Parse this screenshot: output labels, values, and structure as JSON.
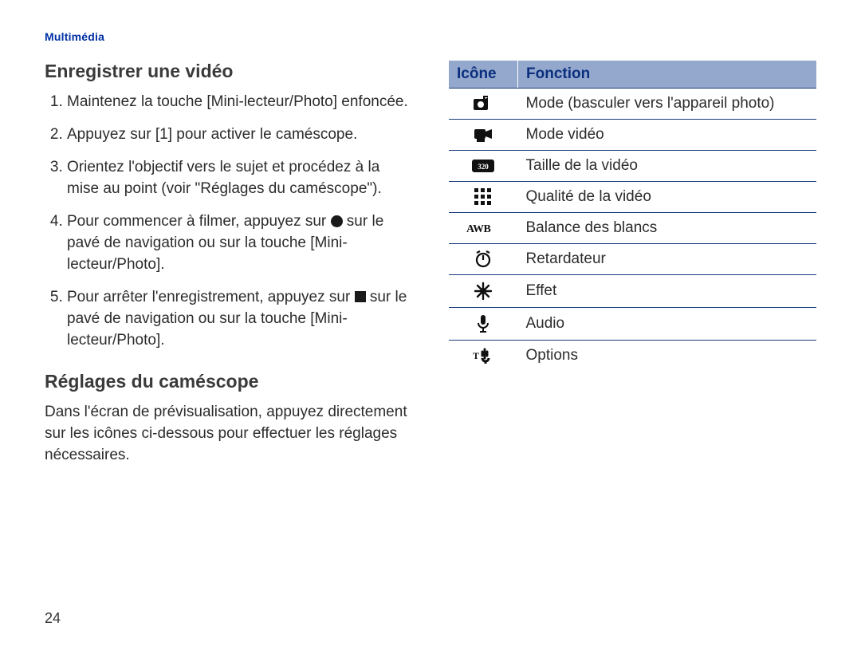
{
  "header": {
    "section": "Multimédia"
  },
  "left": {
    "h1": "Enregistrer une vidéo",
    "steps": [
      "Maintenez la touche [Mini-lecteur/Photo] enfoncée.",
      "Appuyez sur [1] pour activer le caméscope.",
      "Orientez l'objectif vers le sujet et procédez à la mise au point (voir \"Réglages du caméscope\").",
      {
        "pre": "Pour commencer à filmer, appuyez sur ",
        "glyph": "dot",
        "post": " sur le pavé de navigation ou sur la touche [Mini-lecteur/Photo]."
      },
      {
        "pre": "Pour arrêter l'enregistrement, appuyez sur ",
        "glyph": "square",
        "post": " sur le pavé de navigation ou sur la touche [Mini-lecteur/Photo]."
      }
    ],
    "h2": "Réglages du caméscope",
    "intro": "Dans l'écran de prévisualisation, appuyez directement sur les icônes ci-dessous pour effectuer les réglages nécessaires."
  },
  "table": {
    "head_icon": "Icône",
    "head_fn": "Fonction",
    "rows": [
      {
        "icon": "camera-switch-icon",
        "label": "Mode (basculer vers l'appareil photo)"
      },
      {
        "icon": "video-mode-icon",
        "label": "Mode vidéo"
      },
      {
        "icon": "video-size-icon",
        "label": "Taille de la vidéo"
      },
      {
        "icon": "video-quality-icon",
        "label": "Qualité de la vidéo"
      },
      {
        "icon": "white-balance-icon",
        "label": "Balance des blancs"
      },
      {
        "icon": "self-timer-icon",
        "label": "Retardateur"
      },
      {
        "icon": "effect-icon",
        "label": "Effet"
      },
      {
        "icon": "audio-icon",
        "label": "Audio"
      },
      {
        "icon": "options-icon",
        "label": "Options"
      }
    ]
  },
  "page_number": "24"
}
